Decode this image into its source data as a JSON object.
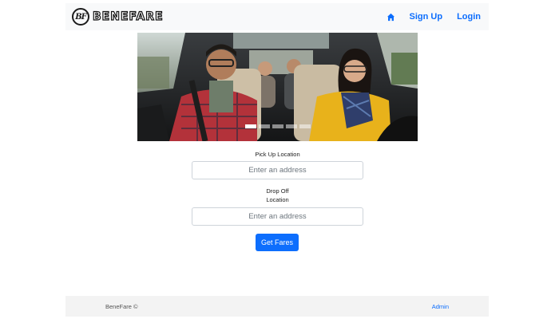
{
  "navbar": {
    "brand_initials": "BF",
    "brand_name": "BeneFare",
    "home_icon": "home-icon",
    "links": [
      "Sign Up",
      "Login"
    ]
  },
  "carousel": {
    "indicator_count": 5,
    "active_index": 0
  },
  "form": {
    "pickup_label": "Pick Up Location",
    "pickup_placeholder": "Enter an address",
    "dropoff_label_line1": "Drop Off",
    "dropoff_label_line2": "Location",
    "dropoff_placeholder": "Enter an address",
    "submit_label": "Get Fares"
  },
  "footer": {
    "brand": "BeneFare ©",
    "admin_link": "Admin"
  },
  "colors": {
    "link": "#0d6efd",
    "button": "#0d6efd",
    "navbar_bg": "#f8f9fa",
    "footer_bg": "#f3f3f3"
  }
}
